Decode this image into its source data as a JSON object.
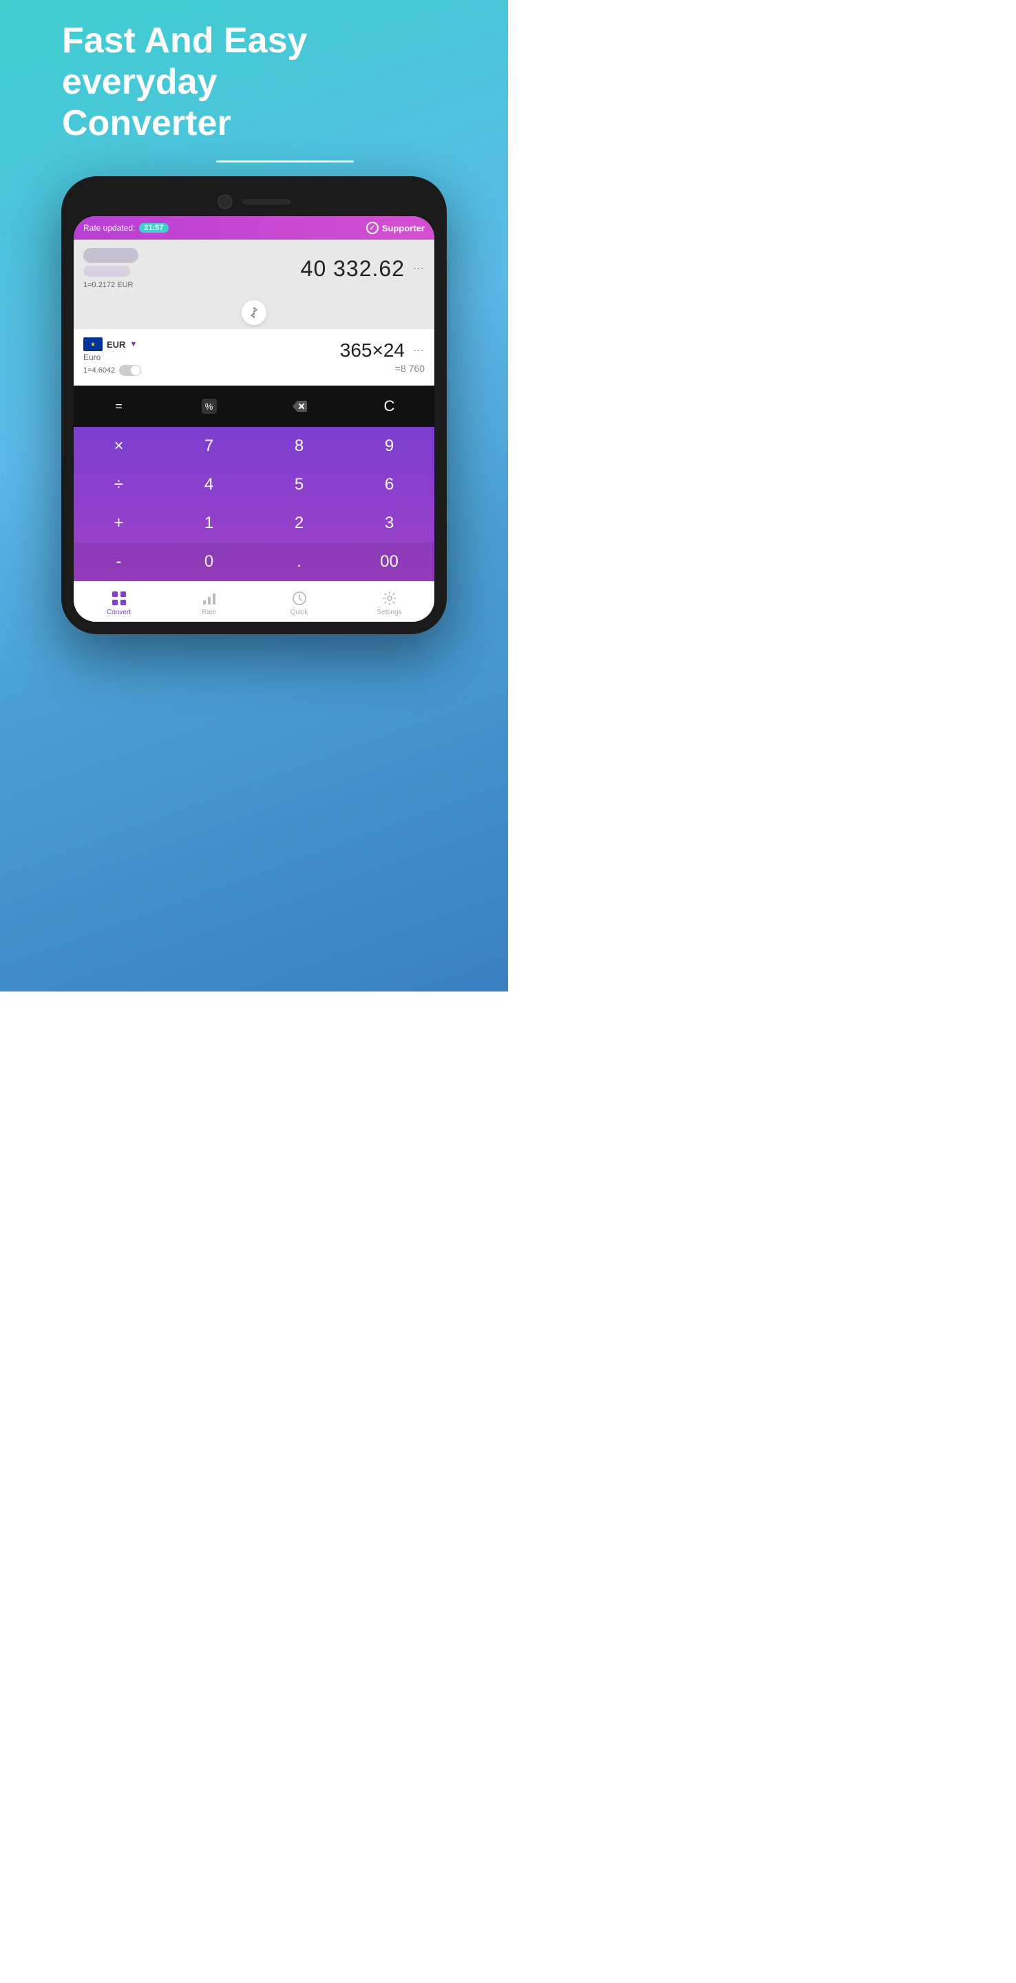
{
  "hero": {
    "line1": "Fast And Easy",
    "line2": "everyday",
    "line3": "Converter"
  },
  "app": {
    "header": {
      "rate_label": "Rate updated:",
      "rate_time": "21:57",
      "supporter_label": "Supporter"
    },
    "row1": {
      "rate_text": "1=0.2172 EUR",
      "value": "40 332.62"
    },
    "row2": {
      "currency_code": "EUR",
      "currency_name": "Euro",
      "rate_text": "1=4.6042",
      "expression": "365×24",
      "result": "=8 760"
    },
    "keypad": {
      "ops": [
        "=",
        "%",
        "⌫",
        "C"
      ],
      "rows": [
        [
          "×",
          "7",
          "8",
          "9"
        ],
        [
          "÷",
          "4",
          "5",
          "6"
        ],
        [
          "+",
          "1",
          "2",
          "3"
        ],
        [
          "-",
          "0",
          ".",
          "00"
        ]
      ]
    },
    "bottom_nav": [
      {
        "label": "Convert",
        "active": true
      },
      {
        "label": "Rate",
        "active": false
      },
      {
        "label": "Quick",
        "active": false
      },
      {
        "label": "Settings",
        "active": false
      }
    ]
  }
}
